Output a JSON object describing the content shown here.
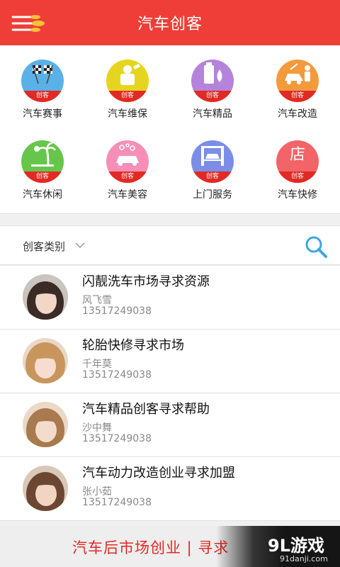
{
  "header": {
    "title": "汽车创客",
    "menu_icon": "menu-icon"
  },
  "colors": {
    "brand_red": "#ee3e37",
    "badge_red": "#e12a23"
  },
  "grid": {
    "badge": "创客",
    "items": [
      {
        "label": "汽车赛事",
        "icon": "racing-flags-icon",
        "color": "#5ab1e8"
      },
      {
        "label": "汽车维保",
        "icon": "mechanic-icon",
        "color": "#e6d51f"
      },
      {
        "label": "汽车精品",
        "icon": "oil-drop-icon",
        "color": "#b583db"
      },
      {
        "label": "汽车改造",
        "icon": "car-repair-icon",
        "color": "#f39a3c"
      },
      {
        "label": "汽车休闲",
        "icon": "palm-tree-icon",
        "color": "#66c64b"
      },
      {
        "label": "汽车美容",
        "icon": "car-wash-icon",
        "color": "#f58fb8"
      },
      {
        "label": "上门服务",
        "icon": "car-lift-icon",
        "color": "#7a8ee8"
      },
      {
        "label": "汽车快修",
        "icon": "shop-icon",
        "color": "#f26468",
        "glyph": "店"
      }
    ]
  },
  "filter": {
    "label": "创客类别",
    "dropdown_icon": "chevron-down-icon",
    "search_icon": "search-icon"
  },
  "list": [
    {
      "title": "闪靓洗车市场寻求资源",
      "author": "风飞雪",
      "phone": "13517249038"
    },
    {
      "title": "轮胎快修寻求市场",
      "author": "千年莫",
      "phone": "13517249038"
    },
    {
      "title": "汽车精品创客寻求帮助",
      "author": "沙中舞",
      "phone": "13517249038"
    },
    {
      "title": "汽车动力改造创业寻求加盟",
      "author": "张小茹",
      "phone": "13517249038"
    }
  ],
  "banner": {
    "text": "汽车后市场创业 | 寻求"
  },
  "watermark": {
    "main": "9L游戏",
    "sub": "91danji.com"
  }
}
